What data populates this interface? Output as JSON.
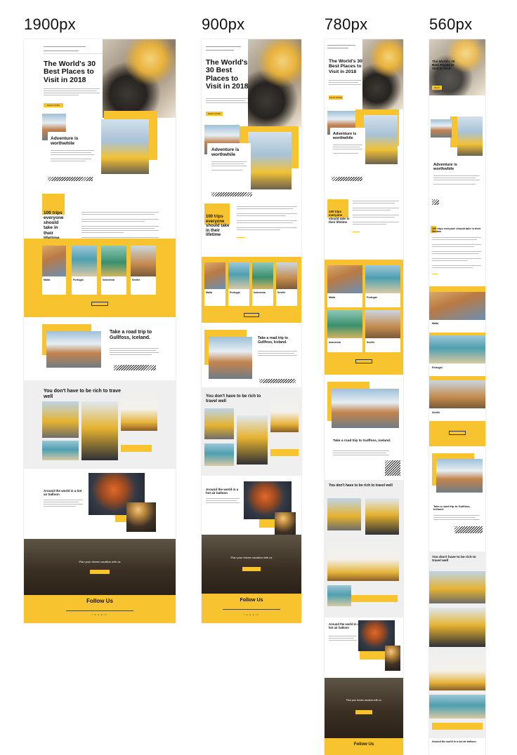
{
  "breakpoints": [
    "1900px",
    "900px",
    "780px",
    "560px"
  ],
  "hero": {
    "title": "The World's 30 Best Places to Visit in 2018",
    "read_more": "READ MORE"
  },
  "sections": {
    "adventure": "Adventure is worthwhile",
    "trips": "100 trips everyone should take in their lifetime",
    "roadtrip": "Take a road trip to Gullfoss, Iceland.",
    "rich": "You don't have to be rich to travel well",
    "balloon": "Around the world in a hot air balloon",
    "plan": "Plan your dream vacation with us",
    "follow": "Follow Us"
  },
  "destinations": [
    "Malta",
    "Portugal",
    "Indonesia",
    "Seville"
  ],
  "icons": [
    "facebook-icon",
    "twitter-icon",
    "pinterest-icon",
    "instagram-icon",
    "linkedin-icon"
  ],
  "colors": {
    "accent": "#f7c32e"
  }
}
